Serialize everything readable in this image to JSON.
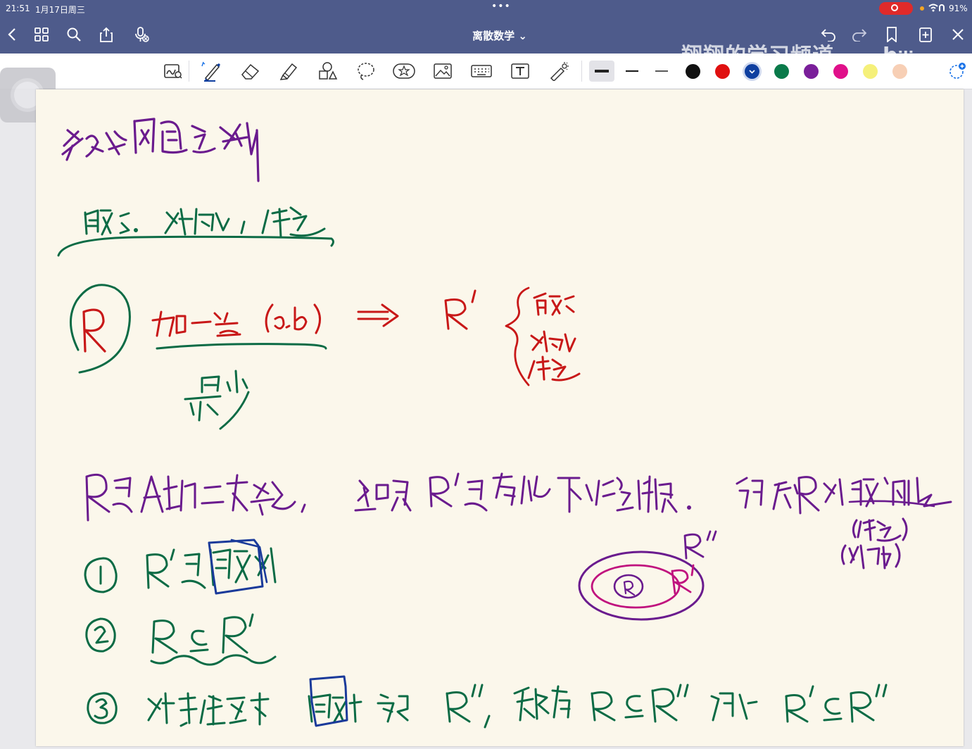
{
  "status": {
    "time": "21:51",
    "date": "1月17日周三",
    "battery": "91%"
  },
  "nav": {
    "title": "离散数学 ⌄",
    "watermark": "翔翔的学习频道",
    "logo": "bilibili"
  },
  "toolbar": {
    "tools": [
      "handwriting-ocr-icon",
      "pen-icon",
      "eraser-icon",
      "highlighter-icon",
      "shapes-icon",
      "lasso-icon",
      "sticker-icon",
      "image-icon",
      "keyboard-icon",
      "textbox-icon",
      "laser-pointer-icon"
    ],
    "strokes": [
      "thick",
      "medium",
      "thin"
    ],
    "colors": [
      "#111111",
      "#e01010",
      "#0f3fa0",
      "#0a7a4a",
      "#7a1f9a",
      "#e0108a",
      "#f5f07a",
      "#f7cfb5"
    ],
    "selected_color": "#0f3fa0"
  },
  "ink": {
    "purple": "#6a1b8e",
    "green": "#0b6b45",
    "red": "#c81818",
    "blue": "#1a3a9a",
    "magenta": "#c0127e"
  }
}
